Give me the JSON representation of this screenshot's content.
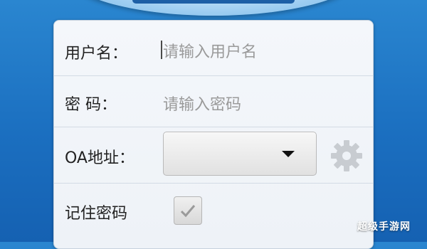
{
  "form": {
    "username_label": "用户名：",
    "username_placeholder": "请输入用户名",
    "password_label": "密 码：",
    "password_placeholder": "请输入密码",
    "oa_label": "OA地址：",
    "oa_value": "",
    "remember_label": "记住密码",
    "remember_checked": true
  },
  "icons": {
    "settings": "gear-icon",
    "dropdown": "chevron-down-icon",
    "checkmark": "checkmark-icon"
  },
  "colors": {
    "background": "#1b6fc0",
    "panel": "#f2f5f9",
    "placeholder": "#9a9a9a"
  },
  "watermark": "超级手游网"
}
